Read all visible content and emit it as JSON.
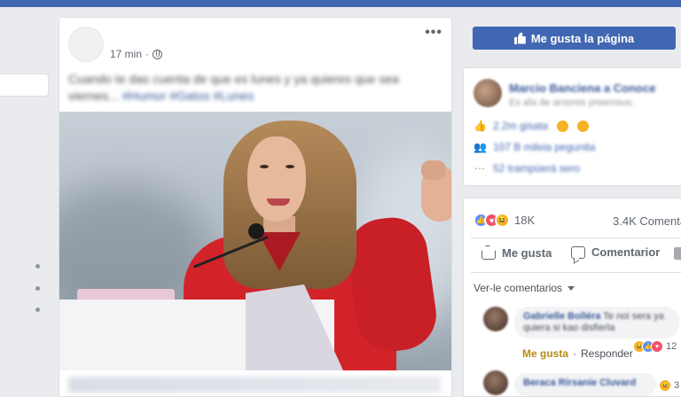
{
  "post": {
    "time": "17 min",
    "menu": "•••",
    "caption_text": "Cuando te das cuenta de que es lunes y ya quieres que sea viernes...",
    "caption_tags": "#Humor #Gatos #Lunes"
  },
  "sidebar": {
    "like_page_button": "Me gusta la página",
    "page_name": "Marcio Banciena a Conoce",
    "page_subtitle": "Es afa de aroores preemsus.",
    "stats": [
      {
        "icon": "thumbs-up-icon",
        "text": "2.2m gisata"
      },
      {
        "icon": "people-icon",
        "text": "107 B mileia pegunita"
      },
      {
        "icon": "dots-icon",
        "text": "52 trampüerá sero"
      }
    ]
  },
  "engagement": {
    "reactions_count": "18K",
    "comments_count": "3.4K Comenta",
    "like_action": "Me gusta",
    "comment_action": "Comentarior",
    "view_comments": "Ver-le comentarios"
  },
  "comments": [
    {
      "name": "Gabrielle Bolléra",
      "text": "Te noi sera ya quiera si kao disfierla",
      "like_label": "Me gusta",
      "reply_label": "Responder",
      "reaction_count": "12"
    },
    {
      "name": "Beraca Rirsanie Cluvard",
      "text": "",
      "reaction_count": "3"
    }
  ],
  "colors": {
    "brand": "#4267b2",
    "link": "#365899",
    "background": "#e9ebee",
    "like_reaction": "#5890ff",
    "love_reaction": "#f25268",
    "haha_reaction": "#f7b125"
  }
}
